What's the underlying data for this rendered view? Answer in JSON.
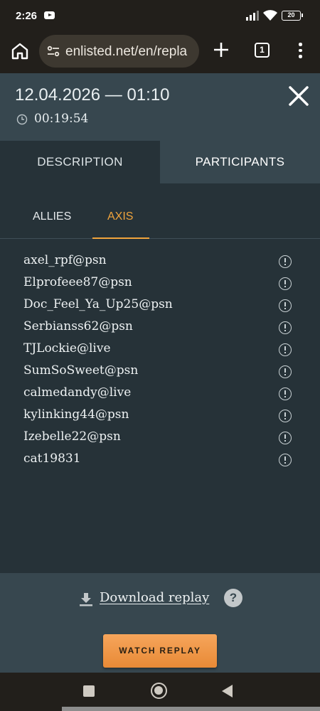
{
  "status_bar": {
    "time": "2:26",
    "battery": "20",
    "icons": [
      "youtube-icon",
      "signal-icon",
      "wifi-icon",
      "battery-icon"
    ]
  },
  "browser": {
    "url": "enlisted.net/en/repla",
    "tab_count": "1",
    "icons": [
      "home-icon",
      "site-info-icon",
      "new-tab-icon",
      "menu-icon"
    ]
  },
  "replay": {
    "date": "12.04.2026 — 01:10",
    "duration": "00:19:54"
  },
  "tabs": {
    "description": "DESCRIPTION",
    "participants": "PARTICIPANTS",
    "active": "DESCRIPTION"
  },
  "teams": {
    "allies": "ALLIES",
    "axis": "AXIS",
    "active": "AXIS"
  },
  "players": [
    "axel_rpf@psn",
    "Elprofeee87@psn",
    "Doc_Feel_Ya_Up25@psn",
    "Serbianss62@psn",
    "TJLockie@live",
    "SumSoSweet@psn",
    "calmedandy@live",
    "kylinking44@psn",
    "Izebelle22@psn",
    "cat19831"
  ],
  "footer": {
    "download_label": "Download replay",
    "help_label": "?",
    "watch_label": "WATCH REPLAY"
  },
  "colors": {
    "accent": "#f0a43c",
    "header_bg": "#37474f",
    "body_bg": "#263238",
    "button": "#f0984a"
  }
}
